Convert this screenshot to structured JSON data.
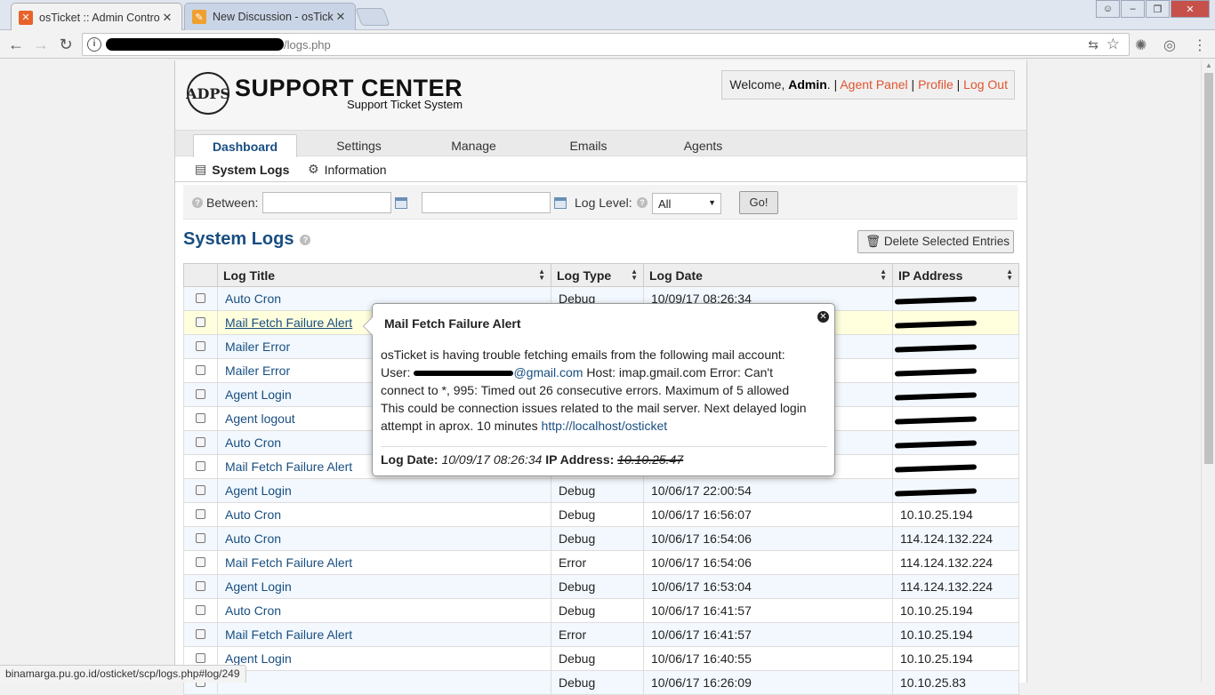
{
  "browser": {
    "tabs": [
      {
        "title": "osTicket :: Admin Control",
        "favicon": "osticket-icon",
        "active": true
      },
      {
        "title": "New Discussion - osTicke",
        "favicon": "forum-icon",
        "active": false
      }
    ],
    "url_visible_part": "/logs.php",
    "status_url": "binamarga.pu.go.id/osticket/scp/logs.php#log/249"
  },
  "header": {
    "logo_mark": "ADPS",
    "logo_title": "SUPPORT CENTER",
    "logo_subtitle": "Support Ticket System",
    "welcome_text": "Welcome,",
    "user_name": "Admin",
    "agent_panel": "Agent Panel",
    "profile": "Profile",
    "logout": "Log Out"
  },
  "nav": {
    "tabs": [
      {
        "label": "Dashboard",
        "active": true
      },
      {
        "label": "Settings",
        "active": false
      },
      {
        "label": "Manage",
        "active": false
      },
      {
        "label": "Emails",
        "active": false
      },
      {
        "label": "Agents",
        "active": false
      }
    ],
    "subnav": [
      {
        "label": "System Logs",
        "icon": "document-icon",
        "active": true
      },
      {
        "label": "Information",
        "icon": "gear-icon",
        "active": false
      }
    ]
  },
  "filter": {
    "between_label": "Between:",
    "from_value": "",
    "to_value": "",
    "log_level_label": "Log Level:",
    "log_level_value": "All",
    "go_label": "Go!"
  },
  "page": {
    "title": "System Logs",
    "delete_button": "Delete Selected Entries"
  },
  "table": {
    "columns": [
      "Log Title",
      "Log Type",
      "Log Date",
      "IP Address"
    ],
    "rows": [
      {
        "title": "Auto Cron",
        "type": "Debug",
        "date": "10/09/17 08:26:34",
        "ip": "",
        "redacted": true
      },
      {
        "title": "Mail Fetch Failure Alert",
        "type": "",
        "date": "",
        "ip": "",
        "redacted": true
      },
      {
        "title": "Mailer Error",
        "type": "",
        "date": "",
        "ip": "",
        "redacted": true
      },
      {
        "title": "Mailer Error",
        "type": "",
        "date": "",
        "ip": "",
        "redacted": true
      },
      {
        "title": "Agent Login",
        "type": "",
        "date": "",
        "ip": "",
        "redacted": true
      },
      {
        "title": "Agent logout",
        "type": "",
        "date": "",
        "ip": "",
        "redacted": true
      },
      {
        "title": "Auto Cron",
        "type": "",
        "date": "",
        "ip": "",
        "redacted": true
      },
      {
        "title": "Mail Fetch Failure Alert",
        "type": "",
        "date": "",
        "ip": "",
        "redacted": true
      },
      {
        "title": "Agent Login",
        "type": "Debug",
        "date": "10/06/17 22:00:54",
        "ip": "",
        "redacted": true
      },
      {
        "title": "Auto Cron",
        "type": "Debug",
        "date": "10/06/17 16:56:07",
        "ip": "10.10.25.194",
        "redacted": false
      },
      {
        "title": "Auto Cron",
        "type": "Debug",
        "date": "10/06/17 16:54:06",
        "ip": "114.124.132.224",
        "redacted": false
      },
      {
        "title": "Mail Fetch Failure Alert",
        "type": "Error",
        "date": "10/06/17 16:54:06",
        "ip": "114.124.132.224",
        "redacted": false
      },
      {
        "title": "Agent Login",
        "type": "Debug",
        "date": "10/06/17 16:53:04",
        "ip": "114.124.132.224",
        "redacted": false
      },
      {
        "title": "Auto Cron",
        "type": "Debug",
        "date": "10/06/17 16:41:57",
        "ip": "10.10.25.194",
        "redacted": false
      },
      {
        "title": "Mail Fetch Failure Alert",
        "type": "Error",
        "date": "10/06/17 16:41:57",
        "ip": "10.10.25.194",
        "redacted": false
      },
      {
        "title": "Agent Login",
        "type": "Debug",
        "date": "10/06/17 16:40:55",
        "ip": "10.10.25.194",
        "redacted": false
      },
      {
        "title": "",
        "type": "Debug",
        "date": "10/06/17 16:26:09",
        "ip": "10.10.25.83",
        "redacted": false
      }
    ]
  },
  "popup": {
    "title": "Mail Fetch Failure Alert",
    "line1": "osTicket is having trouble fetching emails from the following mail account:",
    "user_label": "User:",
    "email_domain": "@gmail.com",
    "line2_rest": " Host: imap.gmail.com Error: Can't",
    "line3": "connect to *, 995: Timed out 26 consecutive errors. Maximum of 5 allowed",
    "line4": "This could be connection issues related to the mail server. Next delayed login",
    "line5": "attempt in aprox. 10 minutes ",
    "link": "http://localhost/osticket",
    "log_date_label": "Log Date:",
    "log_date_value": "10/09/17 08:26:34",
    "ip_label": "IP Address:",
    "ip_value": "10.10.25.47"
  }
}
